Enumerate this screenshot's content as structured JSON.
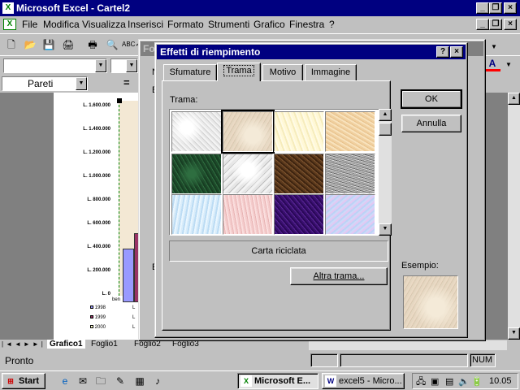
{
  "excel": {
    "title": "Microsoft Excel - Cartel2",
    "menu": [
      "File",
      "Modifica",
      "Visualizza",
      "Inserisci",
      "Formato",
      "Strumenti",
      "Grafico",
      "Finestra",
      "?"
    ],
    "name_box": "Pareti",
    "formula_eq": "=",
    "chart": {
      "y_ticks": [
        "L. 1.600.000",
        "L. 1.400.000",
        "L. 1.200.000",
        "L. 1.000.000",
        "L. 800.000",
        "L. 600.000",
        "L. 400.000",
        "L. 200.000",
        "L. 0"
      ],
      "category_label": "ben",
      "legend": [
        "1998",
        "1999",
        "2000"
      ],
      "legend_value_prefix": "L"
    },
    "sheet_tabs": [
      "Grafico1",
      "Foglio1",
      "Foglio2",
      "Foglio3"
    ],
    "status": "Pronto",
    "num_indicator": "NUM"
  },
  "bg_dialog": {
    "title_fragment": "Fo",
    "side_letters": [
      "N",
      "B",
      "E"
    ]
  },
  "dialog": {
    "title": "Effetti di riempimento",
    "help_btn": "?",
    "close_btn": "×",
    "tabs": [
      "Sfumature",
      "Trama",
      "Motivo",
      "Immagine"
    ],
    "active_tab": "Trama",
    "texture_label": "Trama:",
    "selected_texture_name": "Carta riciclata",
    "ok": "OK",
    "cancel": "Annulla",
    "other_texture": "Altra trama...",
    "sample_label": "Esempio:"
  },
  "taskbar": {
    "start": "Start",
    "tasks": [
      "Microsoft E...",
      "excel5 - Micro..."
    ],
    "clock": "10.05"
  }
}
